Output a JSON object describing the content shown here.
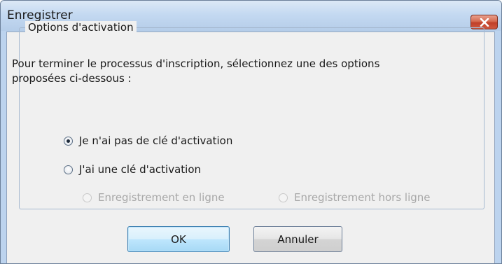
{
  "window": {
    "title": "Enregistrer"
  },
  "group": {
    "legend": "Options d'activation"
  },
  "instruction": {
    "line1": "Pour terminer le processus d'inscription, sélectionnez une des options",
    "line2": "proposées ci-dessous :"
  },
  "options": {
    "no_key": {
      "label": "Je n'ai pas de clé d'activation",
      "checked": true,
      "enabled": true
    },
    "have_key": {
      "label": "J'ai une clé d'activation",
      "checked": false,
      "enabled": true
    },
    "online": {
      "label": "Enregistrement en ligne",
      "checked": false,
      "enabled": false
    },
    "offline": {
      "label": "Enregistrement hors ligne",
      "checked": false,
      "enabled": false
    }
  },
  "buttons": {
    "ok": "OK",
    "cancel": "Annuler"
  },
  "icons": {
    "close": "close-icon"
  },
  "colors": {
    "titlebar": "#c4d9f1",
    "close_button": "#c0402a",
    "dialog_background": "#f0f0f0",
    "disabled_text": "#a8a8a8",
    "default_button": "#bee6fd"
  }
}
